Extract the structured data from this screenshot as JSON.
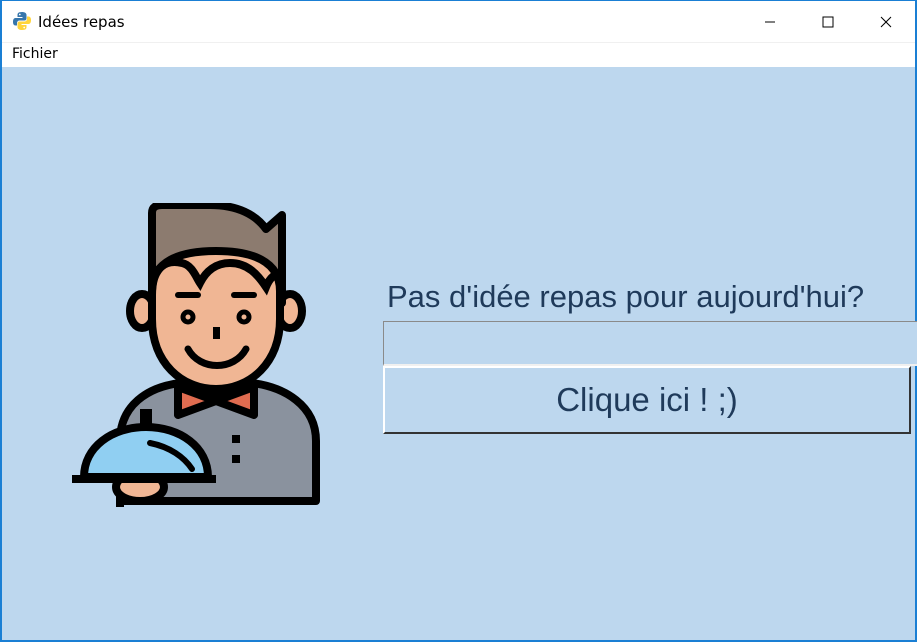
{
  "window": {
    "title": "Idées repas",
    "app_icon": "python-icon",
    "controls": [
      "minimize-icon",
      "maximize-icon",
      "close-icon"
    ]
  },
  "menu": {
    "items": [
      {
        "label": "Fichier"
      }
    ]
  },
  "main": {
    "illustration": "waiter-with-cloche-illustration",
    "question": "Pas d'idée repas pour aujourd'hui?",
    "answer_value": "",
    "button_label": "Clique ici ! ;)"
  },
  "colors": {
    "background": "#bdd7ee",
    "text": "#1f3a5a",
    "window_border": "#1a7fd4"
  }
}
